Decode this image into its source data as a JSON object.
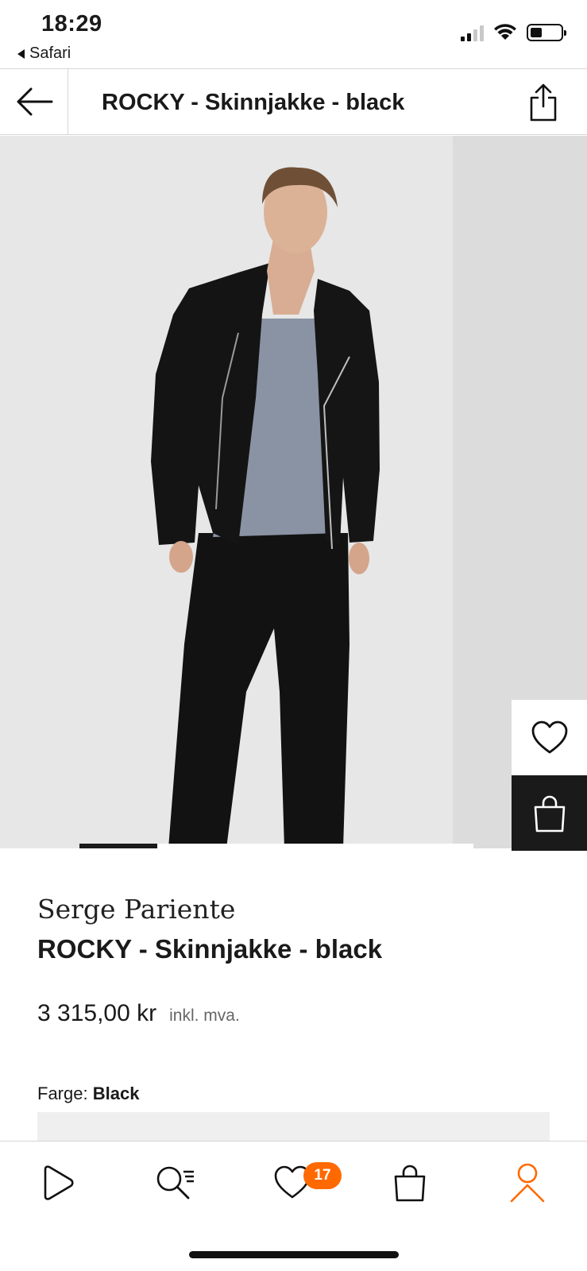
{
  "status_bar": {
    "time": "18:29",
    "back_app": "Safari"
  },
  "header": {
    "title": "ROCKY - Skinnjakke - black",
    "back_icon": "arrow-left-icon",
    "share_icon": "share-icon"
  },
  "gallery": {
    "image_alt": "Model wearing black leather biker jacket",
    "current_index": 1,
    "wishlist_icon": "heart-icon",
    "cart_icon": "shopping-bag-icon"
  },
  "product": {
    "brand": "Serge Pariente",
    "name": "ROCKY - Skinnjakke - black",
    "price": "3 315,00 kr",
    "tax_note": "inkl. mva.",
    "color_label": "Farge:",
    "color_value": "Black"
  },
  "tab_bar": {
    "items": [
      {
        "name": "discover",
        "icon": "play-icon"
      },
      {
        "name": "search",
        "icon": "search-list-icon"
      },
      {
        "name": "wishlist",
        "icon": "heart-icon",
        "badge": "17"
      },
      {
        "name": "bag",
        "icon": "shopping-bag-icon"
      },
      {
        "name": "profile",
        "icon": "user-icon"
      }
    ],
    "accent_color": "#ff6900"
  }
}
